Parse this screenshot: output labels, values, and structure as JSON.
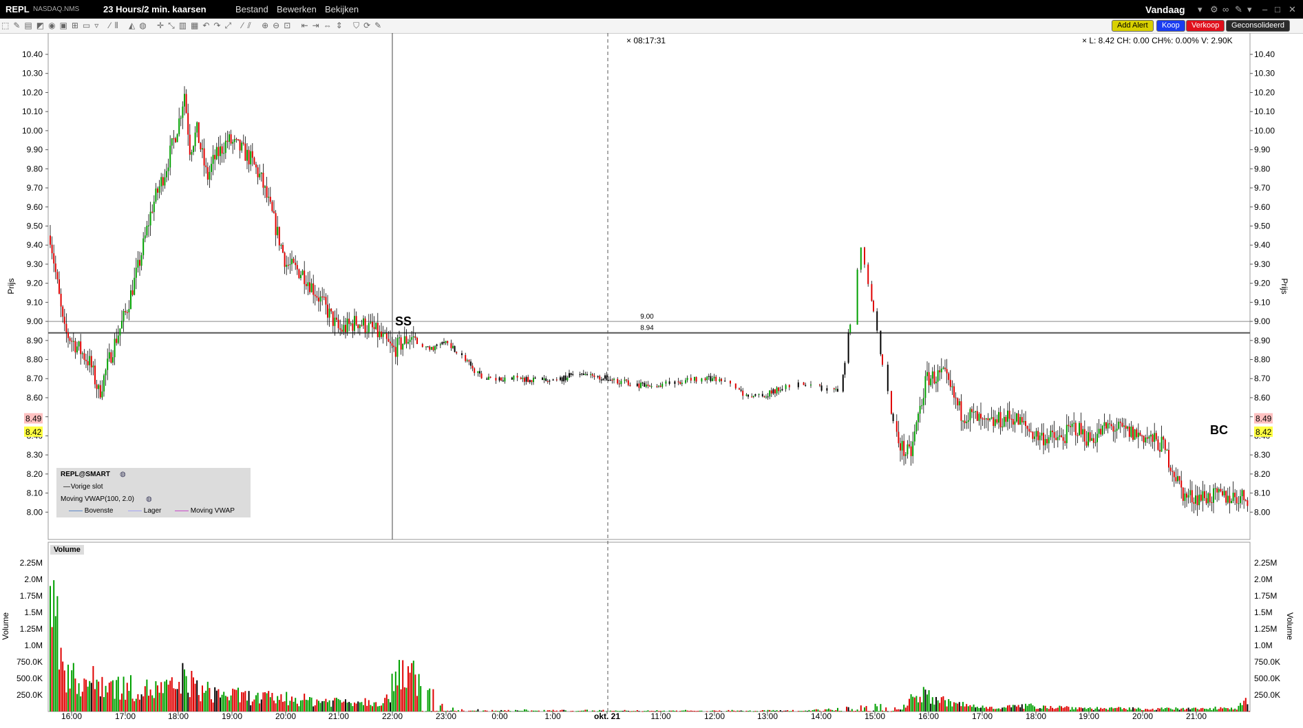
{
  "titlebar": {
    "symbol": "REPL",
    "exchange": "NASDAQ.NMS",
    "period": "23 Hours/2 min. kaarsen",
    "menu_file": "Bestand",
    "menu_edit": "Bewerken",
    "menu_view": "Bekijken",
    "range": "Vandaag"
  },
  "toolbar": {
    "add_alert": "Add Alert",
    "buy": "Koop",
    "sell": "Verkoop",
    "consolidated": "Geconsolideerd"
  },
  "readout": {
    "crosshair_time": "08:17:31",
    "quote": "L: 8.42 CH: 0.00 CH%: 0.00% V: 2.90K"
  },
  "legend": {
    "title": "REPL@SMART",
    "prev_close": "Vorige slot",
    "indicator": "Moving VWAP(100, 2.0)",
    "upper": "Bovenste",
    "lower": "Lager",
    "vwap": "Moving VWAP"
  },
  "colors": {
    "up": "#00a000",
    "down": "#e00000",
    "vwap_upper": "#1f5fbf",
    "vwap_lower": "#8a8aff",
    "vwap_mid": "#c000c0"
  },
  "chart_data": [
    {
      "type": "candlestick",
      "ylabel": "Prijs",
      "ylim": [
        7.96,
        10.45
      ],
      "yticks": [
        "10.40",
        "10.30",
        "10.20",
        "10.10",
        "10.00",
        "9.90",
        "9.80",
        "9.70",
        "9.60",
        "9.50",
        "9.40",
        "9.30",
        "9.20",
        "9.10",
        "9.00",
        "8.90",
        "8.80",
        "8.70",
        "8.60",
        "8.50",
        "8.40",
        "8.30",
        "8.20",
        "8.10",
        "8.00"
      ],
      "xticks": [
        "16:00",
        "17:00",
        "18:00",
        "19:00",
        "20:00",
        "21:00",
        "22:00",
        "23:00",
        "0:00",
        "1:00",
        "okt. 21",
        "11:00",
        "12:00",
        "13:00",
        "14:00",
        "15:00",
        "16:00",
        "17:00",
        "18:00",
        "19:00",
        "20:00",
        "21:00"
      ],
      "price_labels": [
        {
          "value": 8.49,
          "text": "8.49",
          "bg": "#ffc0c0"
        },
        {
          "value": 8.42,
          "text": "8.42",
          "bg": "#ffff40"
        }
      ],
      "horizontal_lines": [
        {
          "value": 9.0,
          "label": "9.00"
        },
        {
          "value": 8.94,
          "label": "8.94"
        }
      ],
      "markers": [
        {
          "label": "SS",
          "time": "22:10",
          "value": 9.0
        },
        {
          "label": "BC",
          "time": "21:30",
          "value": 8.43
        }
      ],
      "price_path": [
        [
          "15:30",
          9.5
        ],
        [
          "15:45",
          8.95
        ],
        [
          "16:00",
          8.9
        ],
        [
          "16:20",
          8.78
        ],
        [
          "16:30",
          8.62
        ],
        [
          "16:45",
          8.85
        ],
        [
          "17:00",
          9.05
        ],
        [
          "17:15",
          9.3
        ],
        [
          "17:30",
          9.6
        ],
        [
          "17:45",
          9.8
        ],
        [
          "18:00",
          10.05
        ],
        [
          "18:10",
          10.2
        ],
        [
          "18:20",
          9.9
        ],
        [
          "18:35",
          10.0
        ],
        [
          "18:50",
          9.75
        ],
        [
          "19:00",
          9.85
        ],
        [
          "19:15",
          9.95
        ],
        [
          "19:30",
          9.9
        ],
        [
          "19:45",
          9.85
        ],
        [
          "20:00",
          9.75
        ],
        [
          "20:15",
          9.55
        ],
        [
          "20:30",
          9.3
        ],
        [
          "20:45",
          9.25
        ],
        [
          "21:00",
          9.1
        ],
        [
          "21:20",
          8.95
        ],
        [
          "21:40",
          9.0
        ],
        [
          "22:00",
          8.95
        ],
        [
          "22:20",
          8.85
        ],
        [
          "22:40",
          8.92
        ],
        [
          "23:00",
          8.85
        ],
        [
          "23:20",
          8.9
        ],
        [
          "23:40",
          8.8
        ],
        [
          "0:00",
          8.7
        ],
        [
          "0:30",
          8.7
        ],
        [
          "1:00",
          8.7
        ],
        [
          "1:30",
          8.68
        ],
        [
          "2:00",
          8.72
        ],
        [
          "10:30",
          8.7
        ],
        [
          "10:50",
          8.68
        ],
        [
          "11:20",
          8.66
        ],
        [
          "11:40",
          8.67
        ],
        [
          "12:00",
          8.68
        ],
        [
          "12:30",
          8.7
        ],
        [
          "13:00",
          8.7
        ],
        [
          "13:20",
          8.65
        ],
        [
          "13:40",
          8.6
        ],
        [
          "14:00",
          8.62
        ],
        [
          "14:20",
          8.66
        ],
        [
          "14:40",
          8.68
        ],
        [
          "15:00",
          8.65
        ],
        [
          "15:20",
          8.63
        ],
        [
          "15:35",
          9.4
        ],
        [
          "15:45",
          8.9
        ],
        [
          "15:55",
          8.4
        ],
        [
          "16:10",
          8.32
        ],
        [
          "16:30",
          8.3
        ],
        [
          "16:50",
          8.45
        ],
        [
          "17:10",
          8.7
        ],
        [
          "17:25",
          8.72
        ],
        [
          "17:40",
          8.52
        ],
        [
          "18:00",
          8.5
        ],
        [
          "18:30",
          8.45
        ],
        [
          "19:00",
          8.48
        ],
        [
          "19:20",
          8.5
        ],
        [
          "19:40",
          8.4
        ],
        [
          "20:00",
          8.38
        ],
        [
          "20:20",
          8.45
        ],
        [
          "20:40",
          8.38
        ],
        [
          "21:00",
          8.45
        ],
        [
          "21:20",
          8.42
        ],
        [
          "21:35",
          8.4
        ],
        [
          "21:45",
          8.35
        ],
        [
          "22:00",
          8.08
        ]
      ]
    },
    {
      "type": "bar",
      "title": "Volume",
      "ylabel": "Volume",
      "yticks": [
        "2.25M",
        "2.0M",
        "1.75M",
        "1.5M",
        "1.25M",
        "1.0M",
        "750.0K",
        "500.0K",
        "250.0K"
      ],
      "ylim": [
        0,
        2.5
      ],
      "unit": "M",
      "volume_profile": [
        [
          "15:30",
          2.45
        ],
        [
          "15:40",
          0.9
        ],
        [
          "16:00",
          0.6
        ],
        [
          "16:30",
          0.55
        ],
        [
          "17:00",
          0.45
        ],
        [
          "17:30",
          0.4
        ],
        [
          "18:00",
          0.45
        ],
        [
          "18:15",
          0.7
        ],
        [
          "18:30",
          0.4
        ],
        [
          "19:00",
          0.3
        ],
        [
          "19:30",
          0.25
        ],
        [
          "20:00",
          0.25
        ],
        [
          "20:30",
          0.2
        ],
        [
          "21:00",
          0.2
        ],
        [
          "21:30",
          0.2
        ],
        [
          "21:55",
          0.5
        ],
        [
          "22:00",
          0.95
        ],
        [
          "22:10",
          0.05
        ],
        [
          "23:00",
          0.03
        ],
        [
          "0:00",
          0.02
        ],
        [
          "10:30",
          0.02
        ],
        [
          "13:00",
          0.03
        ],
        [
          "14:00",
          0.1
        ],
        [
          "15:00",
          0.05
        ],
        [
          "15:35",
          0.35
        ],
        [
          "15:50",
          0.15
        ],
        [
          "16:30",
          0.08
        ],
        [
          "17:00",
          0.1
        ],
        [
          "18:00",
          0.06
        ],
        [
          "19:00",
          0.05
        ],
        [
          "20:00",
          0.05
        ],
        [
          "21:00",
          0.08
        ],
        [
          "21:50",
          0.2
        ],
        [
          "22:00",
          0.45
        ]
      ]
    }
  ]
}
